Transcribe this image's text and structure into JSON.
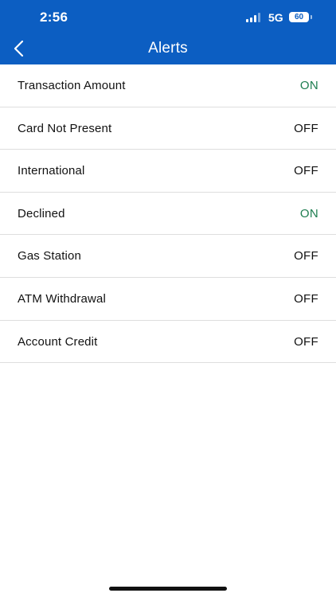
{
  "status_bar": {
    "time": "2:56",
    "network": "5G",
    "battery": "60",
    "icons": [
      "signal-icon",
      "battery-icon"
    ]
  },
  "header": {
    "title": "Alerts",
    "back_icon": "chevron-left-icon"
  },
  "colors": {
    "header_bg": "#0c5ec2",
    "status_on": "#1d7d4f",
    "status_off": "#111111"
  },
  "alerts": [
    {
      "label": "Transaction Amount",
      "status": "ON"
    },
    {
      "label": "Card Not Present",
      "status": "OFF"
    },
    {
      "label": "International",
      "status": "OFF"
    },
    {
      "label": "Declined",
      "status": "ON"
    },
    {
      "label": "Gas Station",
      "status": "OFF"
    },
    {
      "label": "ATM Withdrawal",
      "status": "OFF"
    },
    {
      "label": "Account Credit",
      "status": "OFF"
    }
  ]
}
